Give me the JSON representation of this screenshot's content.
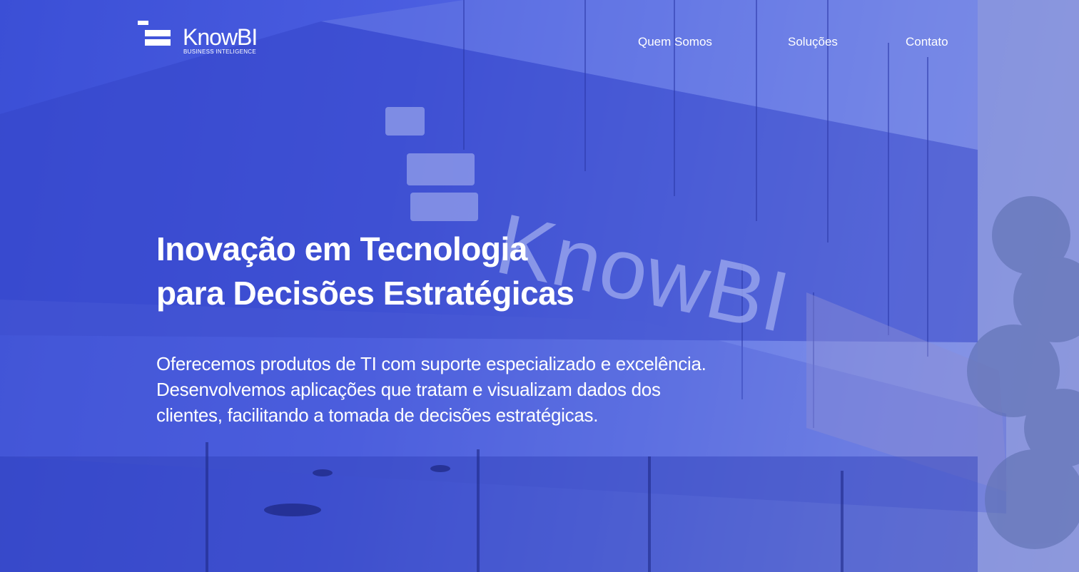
{
  "brand": {
    "name": "KnowBI",
    "tagline": "BUSINESS INTELIGENCE",
    "logo_icon": "stacked-bars-logo-icon"
  },
  "nav": {
    "items": [
      {
        "label": "Quem Somos"
      },
      {
        "label": "Soluções"
      },
      {
        "label": "Contato"
      }
    ]
  },
  "hero": {
    "title_lines": [
      "Inovação em Tecnologia",
      "para Decisões Estratégicas"
    ],
    "description_lines": [
      "Oferecemos produtos de TI com suporte especializado e excelência.",
      "Desenvolvemos aplicações que tratam e visualizam dados dos",
      "clientes, facilitando a tomada de decisões estratégicas."
    ],
    "background_sign_text": "KnowBI"
  },
  "colors": {
    "overlay_blue": "#3b4fd6",
    "text": "#ffffff"
  }
}
